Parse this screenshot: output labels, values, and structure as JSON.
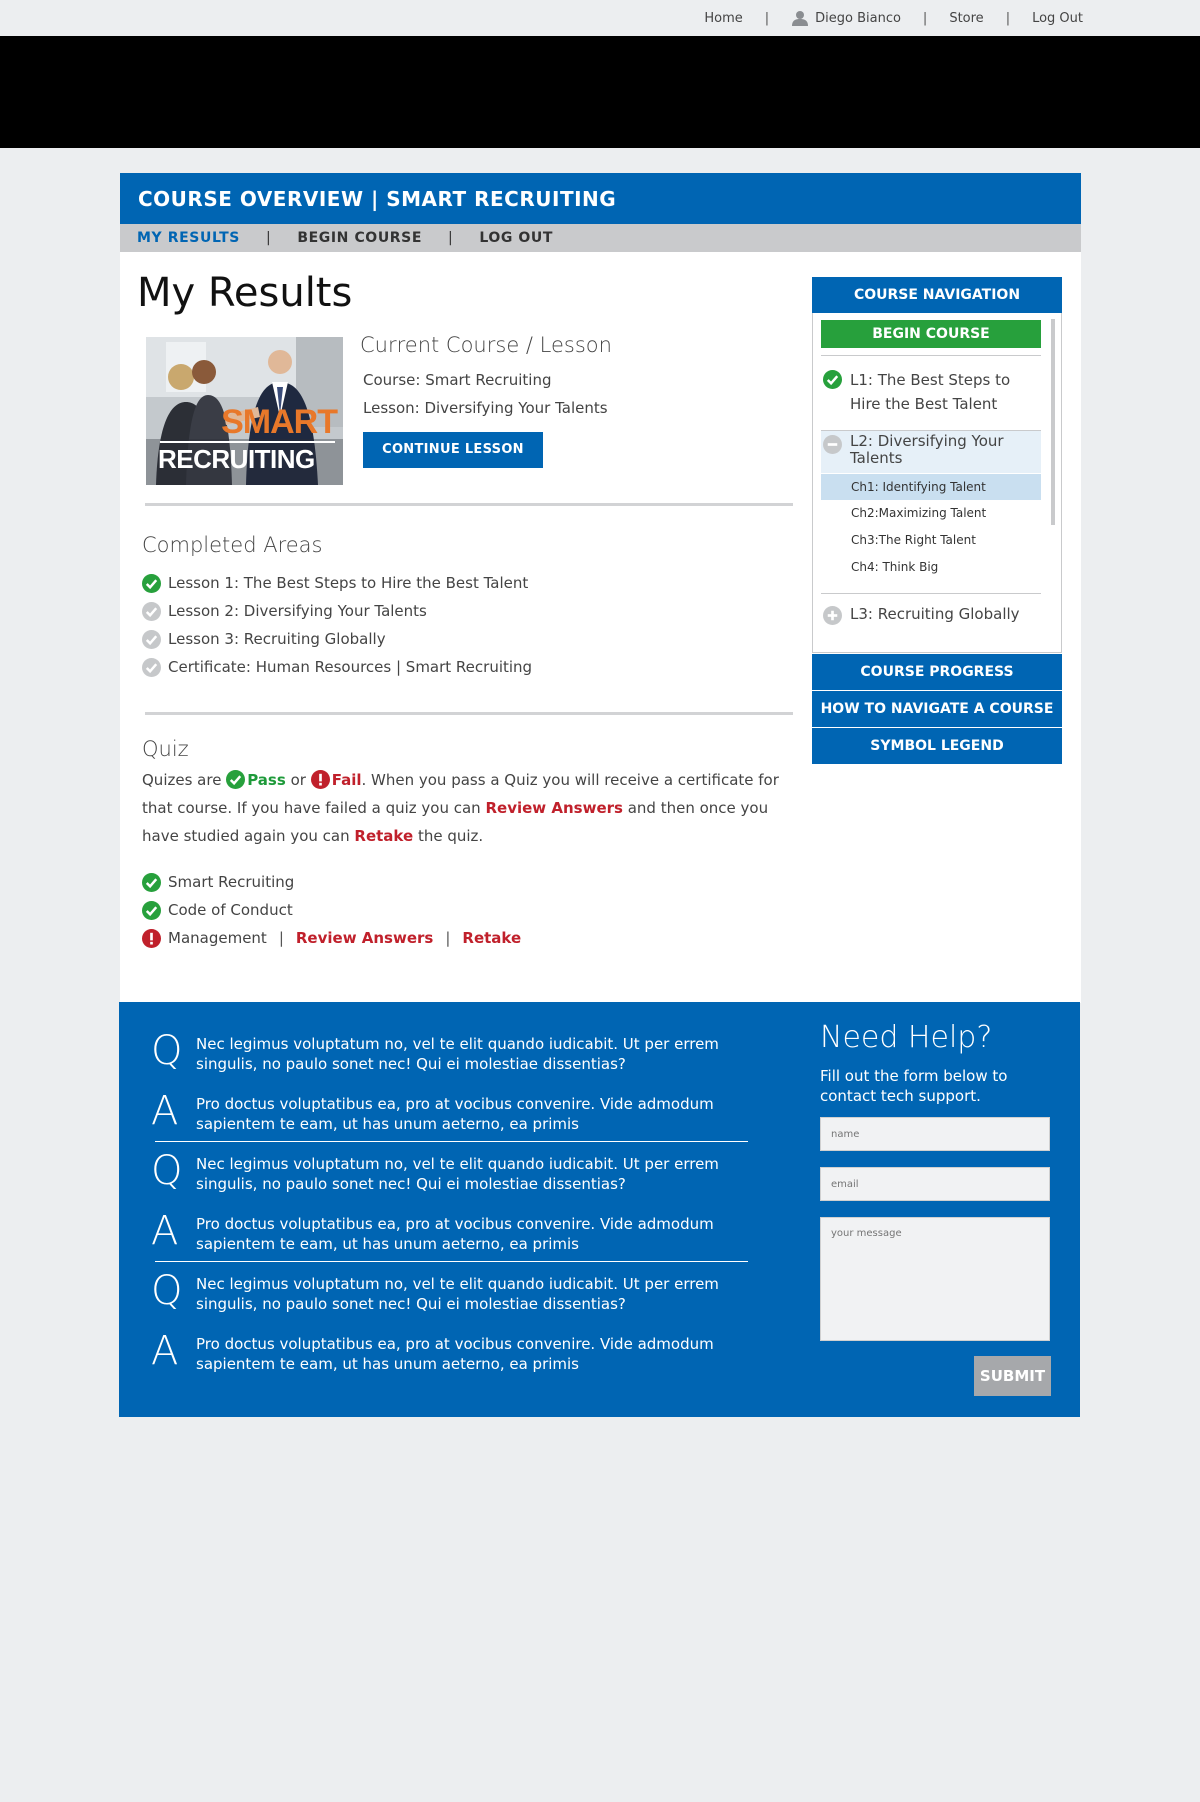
{
  "topnav": {
    "home": "Home",
    "user": "Diego Bianco",
    "store": "Store",
    "logout": "Log Out",
    "sep": "|"
  },
  "course_header": {
    "title": "COURSE OVERVIEW | SMART RECRUITING"
  },
  "subnav": {
    "results": "MY RESULTS",
    "begin": "BEGIN COURSE",
    "logout": "LOG OUT",
    "sep": "|"
  },
  "page": {
    "title": "My Results"
  },
  "course_image": {
    "word1": "SMART",
    "word2": "RECRUITING"
  },
  "current": {
    "heading": "Current Course / Lesson",
    "course": "Course: Smart Recruiting",
    "lesson": "Lesson: Diversifying Your Talents",
    "button": "CONTINUE LESSON"
  },
  "completed": {
    "heading": "Completed Areas",
    "items": [
      {
        "label": "Lesson 1: The Best Steps to Hire the Best Talent",
        "status": "complete"
      },
      {
        "label": "Lesson 2: Diversifying Your Talents",
        "status": "incomplete"
      },
      {
        "label": "Lesson 3: Recruiting Globally",
        "status": "incomplete"
      },
      {
        "label": "Certificate: Human Resources | Smart Recruiting",
        "status": "incomplete"
      }
    ]
  },
  "quiz": {
    "heading": "Quiz",
    "t1": "Quizes are",
    "pass": "Pass",
    "t2": "or",
    "fail": "Fail",
    "t3": ". When you pass a Quiz you will receive a certificate for that course. If you have failed a quiz you can",
    "review": "Review Answers",
    "t4": "and then once you have studied again you can",
    "retake": "Retake",
    "t5": "the quiz.",
    "items": [
      {
        "label": "Smart Recruiting",
        "status": "pass"
      },
      {
        "label": "Code of Conduct",
        "status": "pass"
      },
      {
        "label": "Management",
        "status": "fail",
        "review": "Review Answers",
        "retake": "Retake",
        "sep": "|"
      }
    ]
  },
  "sidenav": {
    "heading": "COURSE NAVIGATION",
    "begin": "BEGIN COURSE",
    "lesson1": "L1: The Best Steps to Hire the Best Talent",
    "lesson2": "L2: Diversifying Your Talents",
    "chapters": [
      "Ch1: Identifying Talent",
      "Ch2:Maximizing Talent",
      "Ch3:The Right Talent",
      "Ch4: Think Big"
    ],
    "lesson3": "L3: Recruiting Globally",
    "progress": "COURSE PROGRESS",
    "how": "HOW TO NAVIGATE A COURSE",
    "legend": "SYMBOL LEGEND"
  },
  "faq": {
    "items": [
      {
        "q_letter": "Q",
        "q": "Nec legimus voluptatum no, vel te elit quando iudicabit. Ut per errem singulis, no paulo sonet nec! Qui ei molestiae dissentias?",
        "a_letter": "A",
        "a": "Pro doctus voluptatibus ea, pro at vocibus convenire. Vide admodum sapientem te eam, ut has unum aeterno, ea primis"
      },
      {
        "q_letter": "Q",
        "q": "Nec legimus voluptatum no, vel te elit quando iudicabit. Ut per errem singulis, no paulo sonet nec! Qui ei molestiae dissentias?",
        "a_letter": "A",
        "a": "Pro doctus voluptatibus ea, pro at vocibus convenire. Vide admodum sapientem te eam, ut has unum aeterno, ea primis"
      },
      {
        "q_letter": "Q",
        "q": "Nec legimus voluptatum no, vel te elit quando iudicabit. Ut per errem singulis, no paulo sonet nec! Qui ei molestiae dissentias?",
        "a_letter": "A",
        "a": "Pro doctus voluptatibus ea, pro at vocibus convenire. Vide admodum sapientem te eam, ut has unum aeterno, ea primis"
      }
    ]
  },
  "help": {
    "heading": "Need Help?",
    "sub": "Fill out the form below to contact tech support.",
    "name_placeholder": "name",
    "email_placeholder": "email",
    "message_placeholder": "your message",
    "submit": "SUBMIT"
  },
  "colors": {
    "brand_blue": "#0065b3",
    "pass_green": "#27a03c",
    "fail_red": "#c0202b"
  }
}
